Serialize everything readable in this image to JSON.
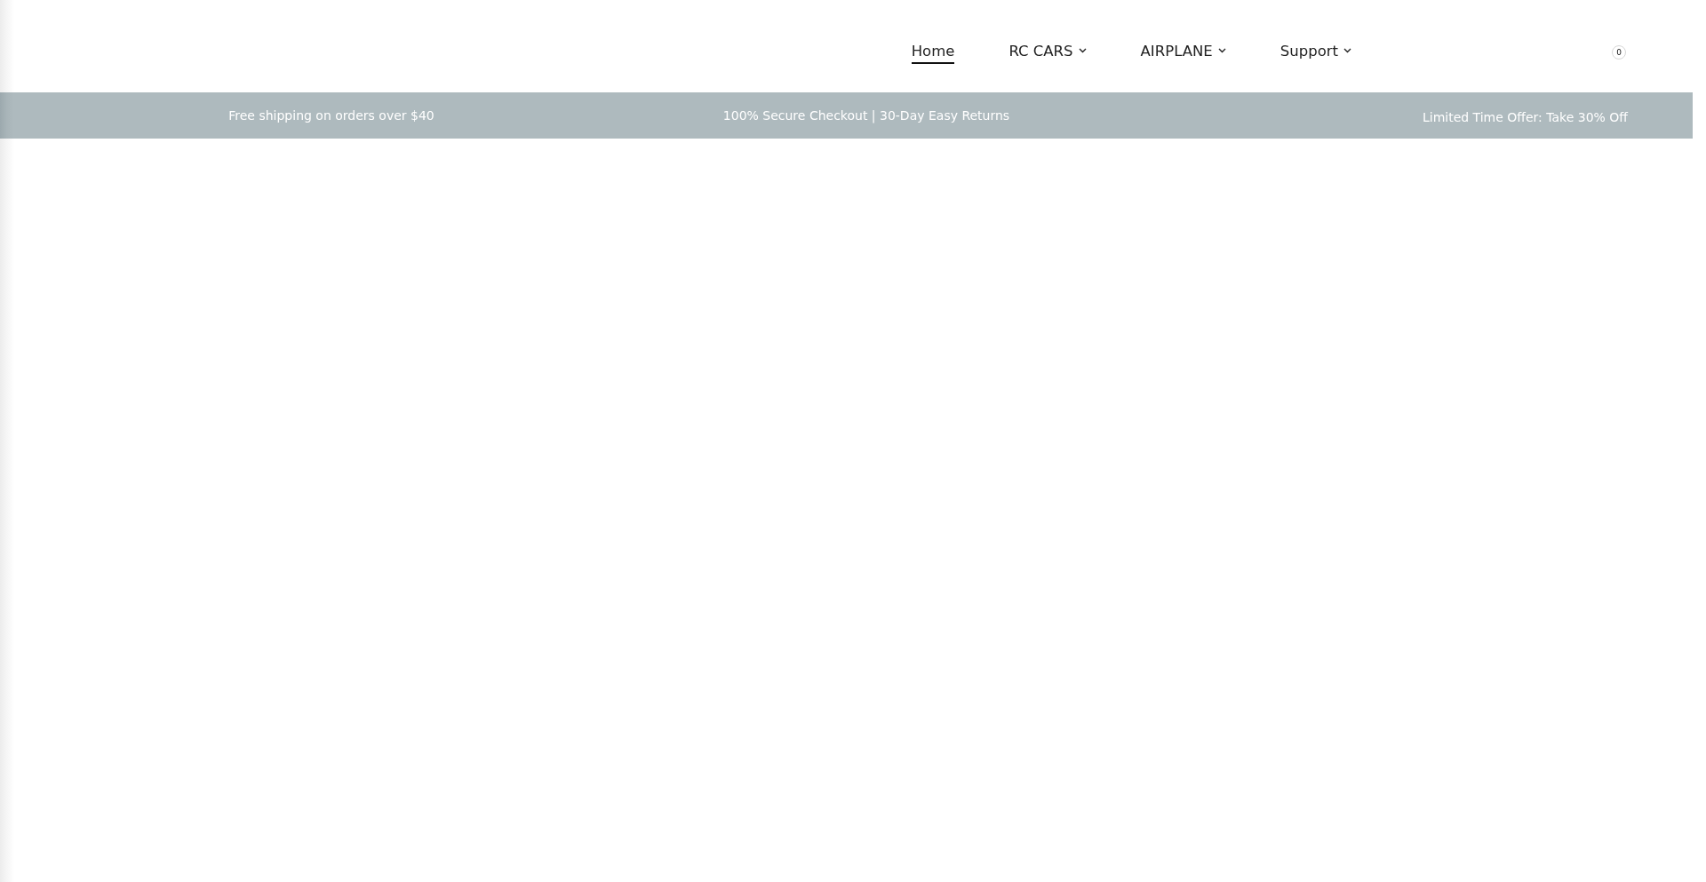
{
  "header": {
    "nav": [
      {
        "label": "Home",
        "kind": "link",
        "selected": true
      },
      {
        "label": "RC CARS",
        "kind": "dropdown",
        "selected": false
      },
      {
        "label": "AIRPLANE",
        "kind": "dropdown",
        "selected": false
      },
      {
        "label": "Support",
        "kind": "dropdown",
        "selected": false
      }
    ],
    "cart_count": "0"
  },
  "announcement_bar": {
    "messages": [
      "Free shipping on orders over $40",
      "100% Secure Checkout | 30-Day Easy Returns",
      "Limited Time Offer: Take 30% Off"
    ]
  }
}
